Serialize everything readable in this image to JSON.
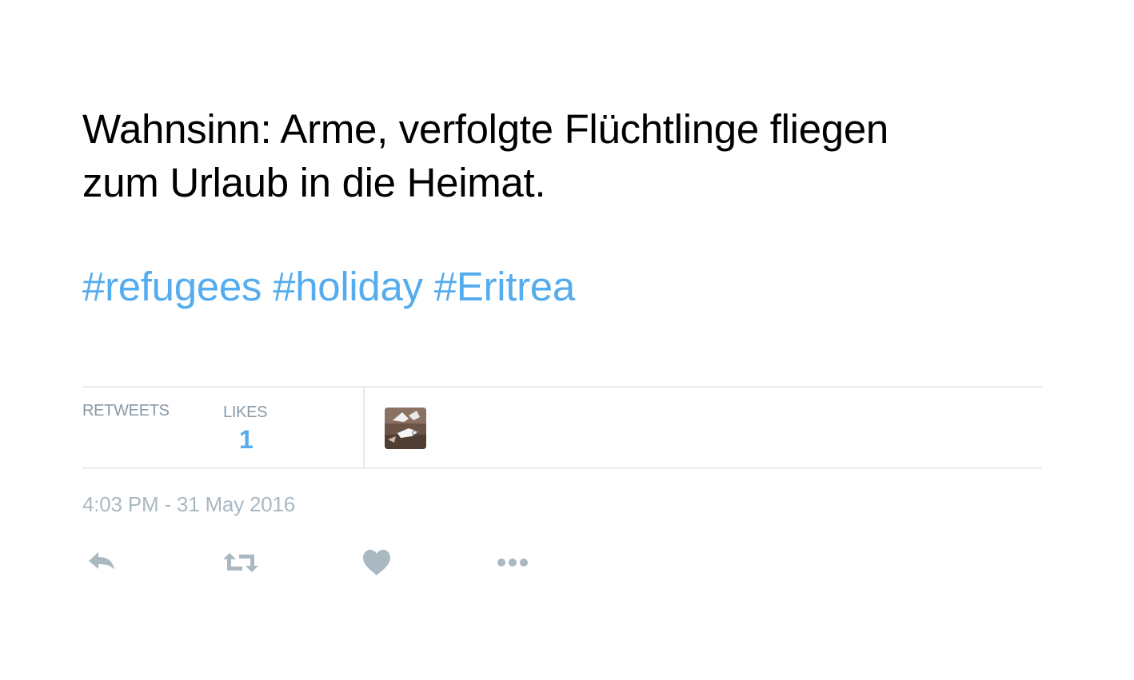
{
  "tweet": {
    "text_lines": [
      "Wahnsinn: Arme, verfolgte Flüchtlinge fliegen",
      "zum Urlaub in die Heimat."
    ],
    "hashtags": [
      "#refugees",
      "#holiday",
      "#Eritrea"
    ],
    "link_color": "#55acee"
  },
  "stats": {
    "retweets_label": "RETWEETS",
    "likes_label": "LIKES",
    "likes_count": "1"
  },
  "timestamp": "4:03 PM - 31 May 2016",
  "actions": {
    "icons": [
      "reply-icon",
      "retweet-icon",
      "heart-icon",
      "more-icon"
    ],
    "icon_color": "#aab8c2"
  }
}
